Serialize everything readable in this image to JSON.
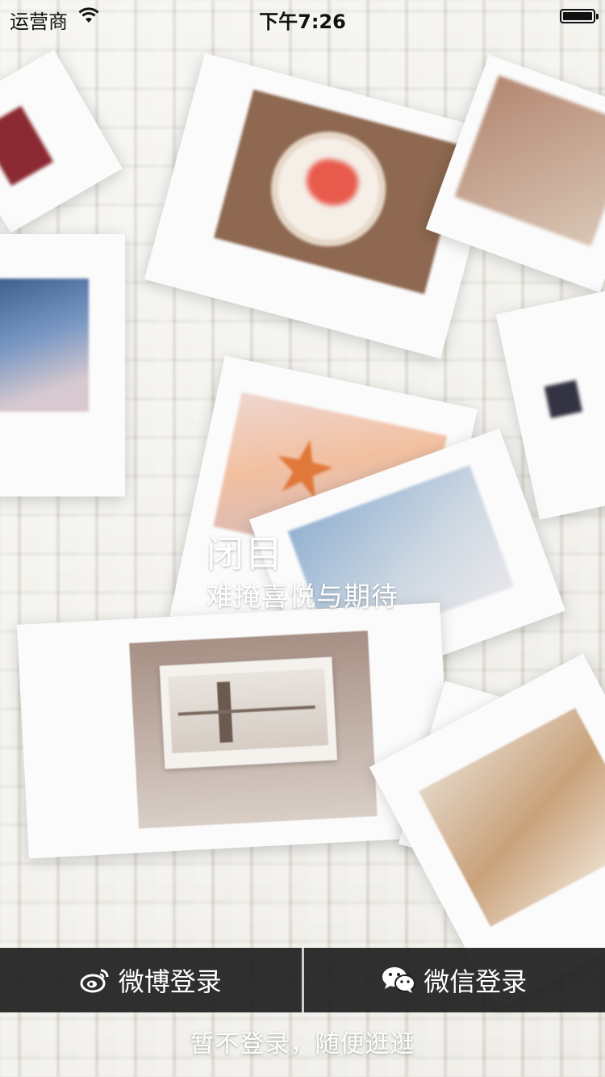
{
  "status_bar": {
    "carrier": "运营商",
    "time": "下午7:26",
    "wifi_icon": "wifi-icon",
    "battery_icon": "battery-icon"
  },
  "hero": {
    "title": "闭目",
    "subtitle": "难掩喜悦与期待"
  },
  "login": {
    "weibo_label": "微博登录",
    "weibo_icon": "weibo-icon",
    "wechat_label": "微信登录",
    "wechat_icon": "wechat-icon",
    "skip_label": "暂不登录，随便逛逛"
  },
  "colors": {
    "bar_background": "#1e1e1e",
    "text": "#ffffff"
  }
}
